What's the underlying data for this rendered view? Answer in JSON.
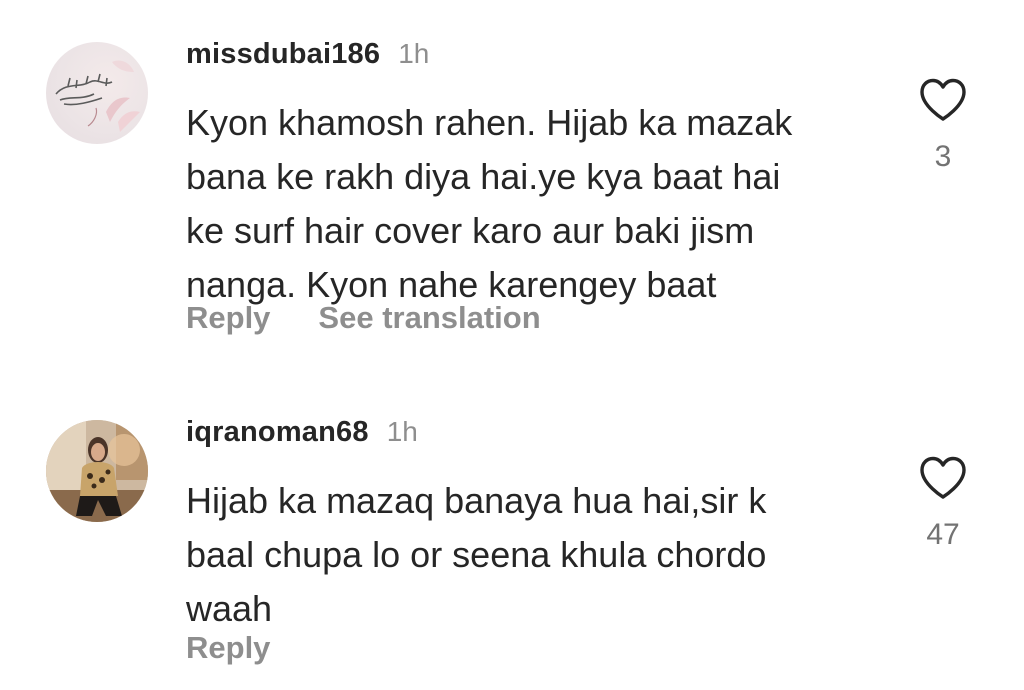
{
  "comments": [
    {
      "username": "missdubai186",
      "time": "1h",
      "text": "Kyon khamosh rahen. Hijab ka mazak\nbana ke rakh diya hai.ye kya baat hai\nke surf hair cover karo aur baki jism\nnanga. Kyon nahe karengey baat",
      "reply_label": "Reply",
      "translate_label": "See translation",
      "likes": "3",
      "avatar_icon": "calligraphy-avatar"
    },
    {
      "username": "iqranoman68",
      "time": "1h",
      "text": "Hijab ka mazaq banaya hua hai,sir k\nbaal chupa lo or seena khula chordo\nwaah",
      "reply_label": "Reply",
      "likes": "47",
      "avatar_icon": "photo-avatar"
    }
  ],
  "icons": {
    "like": "heart-outline-icon"
  },
  "colors": {
    "text": "#262626",
    "secondary": "#8e8e8e",
    "count": "#737373"
  }
}
